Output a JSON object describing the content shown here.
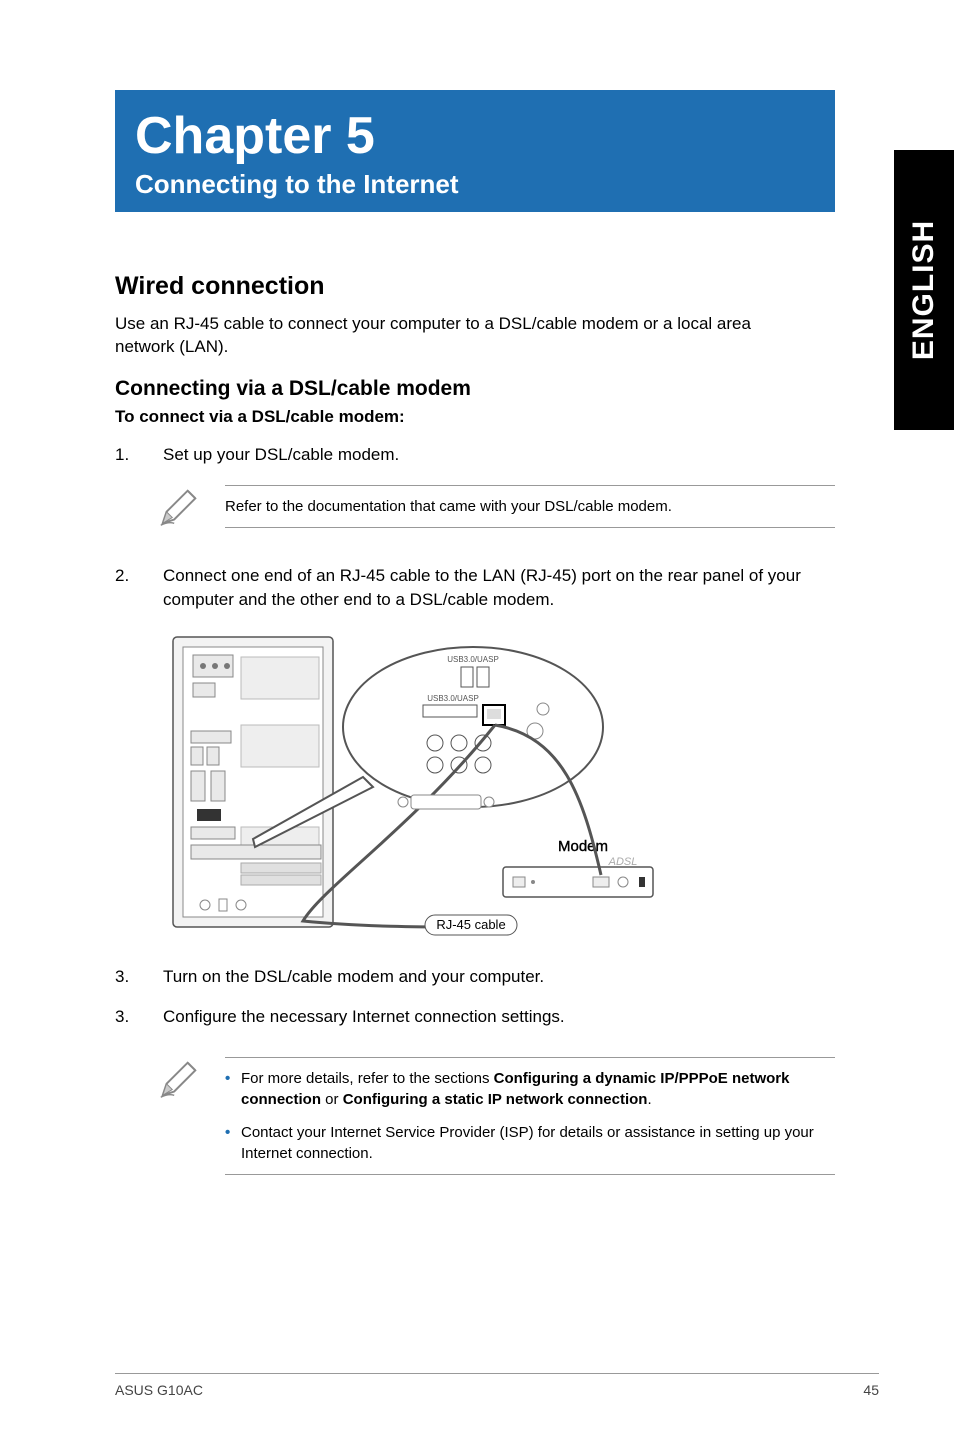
{
  "sideTab": "ENGLISH",
  "chapter": {
    "title": "Chapter 5",
    "subtitle": "Connecting to the Internet"
  },
  "sectionH1": "Wired connection",
  "intro": "Use an RJ-45 cable to connect your computer to a DSL/cable modem or a local area network (LAN).",
  "sectionH2": "Connecting via a DSL/cable modem",
  "sectionH3": "To connect via a DSL/cable modem:",
  "steps": {
    "s1num": "1.",
    "s1text": "Set up your DSL/cable modem.",
    "s2num": "2.",
    "s2text": "Connect one end of an RJ-45 cable to the LAN (RJ-45) port on the rear panel of your computer and the other end to a DSL/cable modem.",
    "s3num": "3.",
    "s3text": "Turn on the DSL/cable modem and your computer.",
    "s4num": "3.",
    "s4text": "Configure the necessary Internet connection settings."
  },
  "note1": "Refer to the documentation that came with your DSL/cable modem.",
  "note2": {
    "b1_prefix": "For more details, refer to the sections ",
    "b1_bold1": "Configuring a dynamic IP/PPPoE network connection",
    "b1_mid": " or ",
    "b1_bold2": "Configuring a static IP network connection",
    "b1_suffix": ".",
    "b2": "Contact your Internet Service Provider (ISP) for details or assistance in setting up your Internet connection."
  },
  "diagram": {
    "modemLabel": "Modem",
    "cableLabel": "RJ-45 cable",
    "adslLabel": "ADSL"
  },
  "footer": {
    "left": "ASUS G10AC",
    "right": "45"
  }
}
